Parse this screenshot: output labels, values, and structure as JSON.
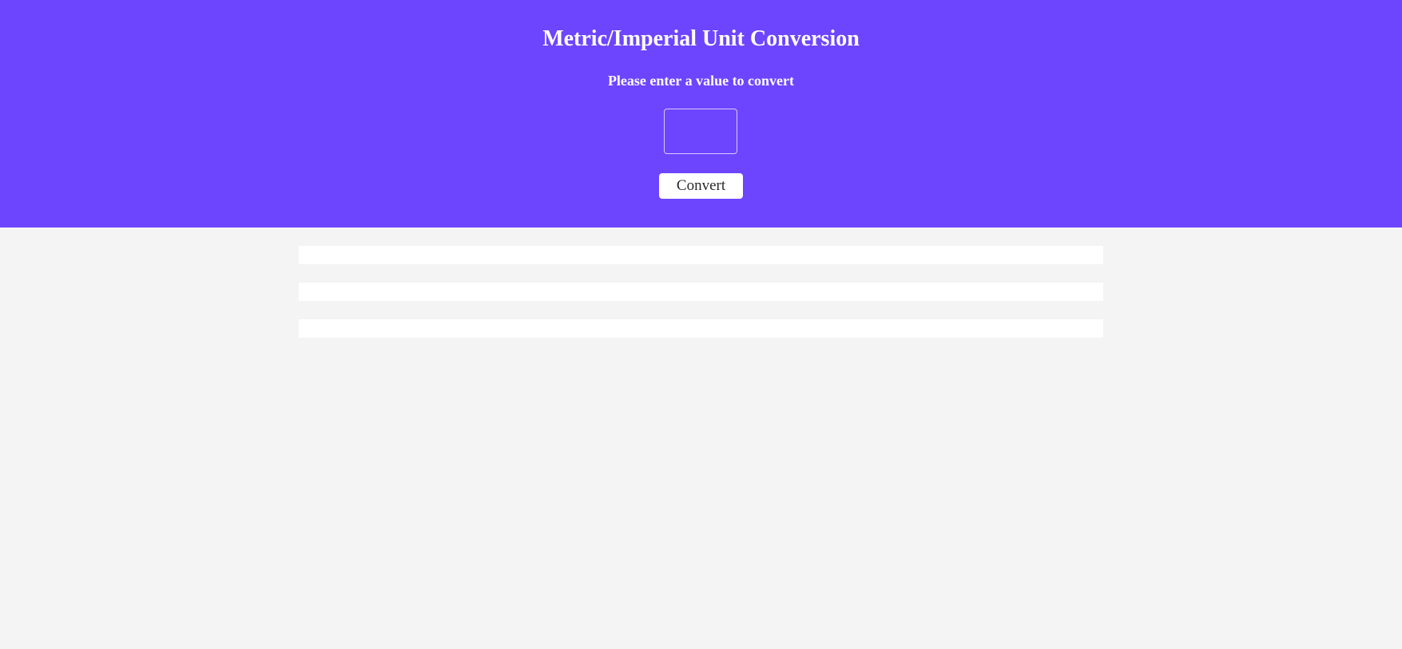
{
  "header": {
    "title": "Metric/Imperial Unit Conversion",
    "subtitle": "Please enter a value to convert",
    "input": {
      "value": "",
      "placeholder": ""
    },
    "convert_label": "Convert"
  },
  "colors": {
    "header_background": "#6d45ff",
    "page_background": "#f4f4f4",
    "result_background": "#ffffff",
    "button_background": "#ffffff"
  },
  "results": [
    {
      "text": ""
    },
    {
      "text": ""
    },
    {
      "text": ""
    }
  ]
}
